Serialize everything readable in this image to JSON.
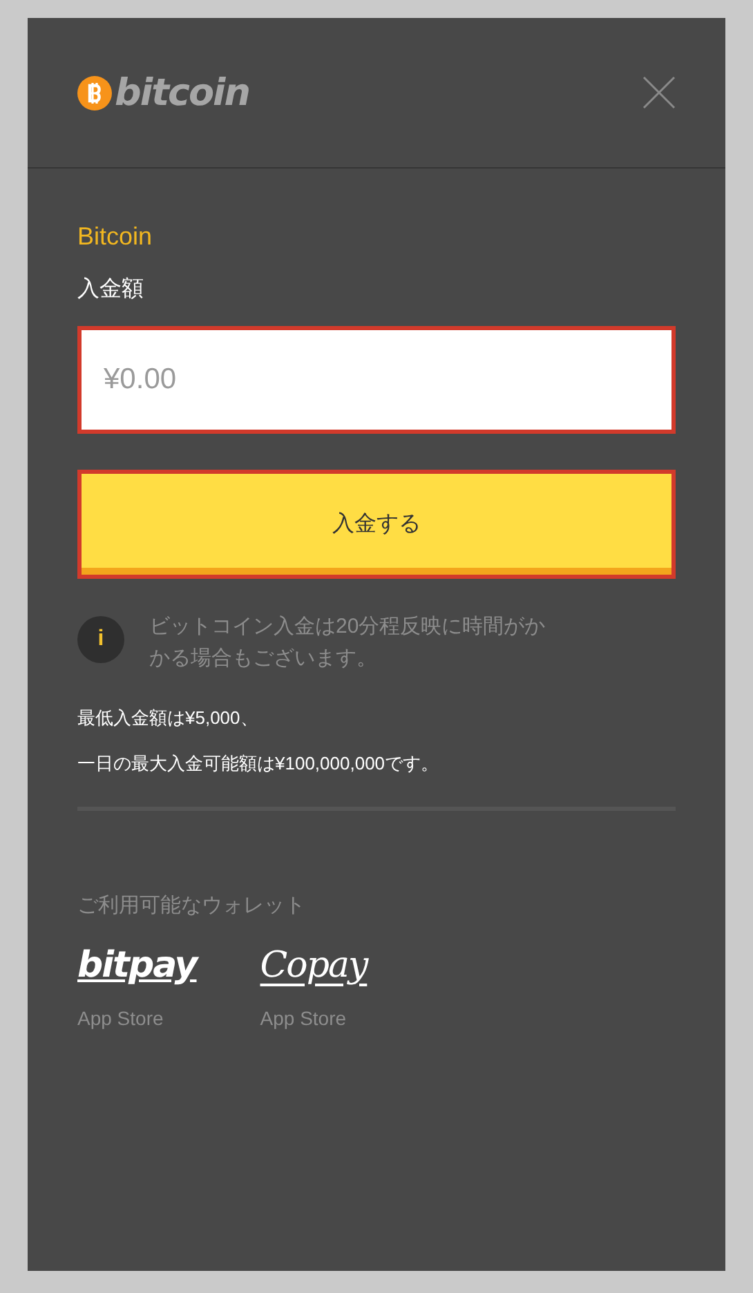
{
  "header": {
    "logo_text": "bitcoin"
  },
  "method": {
    "title": "Bitcoin",
    "amount_label": "入金額",
    "amount_field": {
      "placeholder": "¥0.00"
    },
    "submit": "入金する"
  },
  "info": {
    "icon": "i",
    "text": "ビットコイン入金は20分程反映に時間がかかる場合もございます。"
  },
  "notes": [
    "最低入金額は¥5,000、",
    "一日の最大入金可能額は¥100,000,000です。"
  ],
  "wallets": {
    "title": "ご利用可能なウォレット",
    "items": [
      {
        "kind": "bitpay",
        "logo_text": "bitpay",
        "store": "App Store"
      },
      {
        "kind": "copay",
        "logo_text": "Copay",
        "store": "App Store"
      }
    ]
  }
}
